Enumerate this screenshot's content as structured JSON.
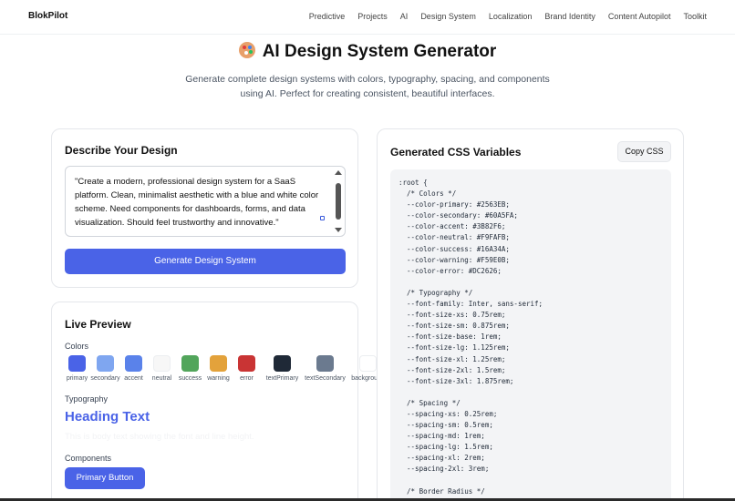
{
  "nav": {
    "brand": "BlokPilot",
    "links": [
      "Predictive",
      "Projects",
      "AI",
      "Design System",
      "Localization",
      "Brand Identity",
      "Content Autopilot",
      "Toolkit"
    ]
  },
  "hero": {
    "icon": "palette-emoji",
    "title": "AI Design System Generator",
    "subtitle": "Generate complete design systems with colors, typography, spacing, and components using AI. Perfect for creating consistent, beautiful interfaces."
  },
  "describe": {
    "title": "Describe Your Design",
    "prompt": "\"Create a modern, professional design system for a SaaS platform. Clean, minimalist aesthetic with a blue and white color scheme. Need components for dashboards, forms, and data visualization. Should feel trustworthy and innovative.\"",
    "generate_label": "Generate Design System"
  },
  "preview": {
    "title": "Live Preview",
    "colors_label": "Colors",
    "swatches": [
      {
        "name": "primary",
        "color": "#4A63E7"
      },
      {
        "name": "secondary",
        "color": "#7FA6F0"
      },
      {
        "name": "accent",
        "color": "#5A82EA"
      },
      {
        "name": "neutral",
        "color": "#F7F7F7"
      },
      {
        "name": "success",
        "color": "#52A55B"
      },
      {
        "name": "warning",
        "color": "#E3A23B"
      },
      {
        "name": "error",
        "color": "#C93434"
      },
      {
        "name": "textPrimary",
        "color": "#1F2937"
      },
      {
        "name": "textSecondary",
        "color": "#6B7A8F"
      },
      {
        "name": "background",
        "color": "#FFFFFF"
      }
    ],
    "typography_label": "Typography",
    "heading_text": "Heading Text",
    "body_text": "This is body text showing the font and line height.",
    "components_label": "Components",
    "primary_button_label": "Primary Button"
  },
  "css_output": {
    "title": "Generated CSS Variables",
    "copy_label": "Copy CSS",
    "lines": [
      ":root {",
      "  /* Colors */",
      "  --color-primary: #2563EB;",
      "  --color-secondary: #60A5FA;",
      "  --color-accent: #3B82F6;",
      "  --color-neutral: #F9FAFB;",
      "  --color-success: #16A34A;",
      "  --color-warning: #F59E0B;",
      "  --color-error: #DC2626;",
      "",
      "  /* Typography */",
      "  --font-family: Inter, sans-serif;",
      "  --font-size-xs: 0.75rem;",
      "  --font-size-sm: 0.875rem;",
      "  --font-size-base: 1rem;",
      "  --font-size-lg: 1.125rem;",
      "  --font-size-xl: 1.25rem;",
      "  --font-size-2xl: 1.5rem;",
      "  --font-size-3xl: 1.875rem;",
      "",
      "  /* Spacing */",
      "  --spacing-xs: 0.25rem;",
      "  --spacing-sm: 0.5rem;",
      "  --spacing-md: 1rem;",
      "  --spacing-lg: 1.5rem;",
      "  --spacing-xl: 2rem;",
      "  --spacing-2xl: 3rem;",
      "",
      "  /* Border Radius */"
    ]
  }
}
